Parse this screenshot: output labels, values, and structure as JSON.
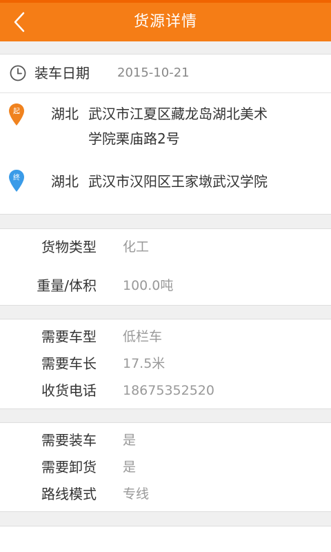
{
  "header": {
    "title": "货源详情",
    "bg_color": "#f57d16",
    "back_icon": "chevron-left-icon"
  },
  "loading": {
    "label": "装车日期",
    "date": "2015-10-21",
    "icon": "clock-icon"
  },
  "route": {
    "origin": {
      "badge": "起",
      "badge_color": "#f0821e",
      "province": "湖北",
      "detail_line1": "武汉市江夏区藏龙岛湖北美术",
      "detail_line2": "学院栗庙路2号"
    },
    "destination": {
      "badge": "终",
      "badge_color": "#3a9be8",
      "province": "湖北",
      "detail": "武汉市汉阳区王家墩武汉学院"
    }
  },
  "cargo": {
    "type_label": "货物类型",
    "type_value": "化工",
    "weight_label": "重量/体积",
    "weight_value": "100.0吨"
  },
  "vehicle": {
    "truck_type_label": "需要车型",
    "truck_type_value": "低栏车",
    "truck_length_label": "需要车长",
    "truck_length_value": "17.5米",
    "phone_label": "收货电话",
    "phone_value": "18675352520"
  },
  "service": {
    "loading_label": "需要装车",
    "loading_value": "是",
    "unloading_label": "需要卸货",
    "unloading_value": "是",
    "route_mode_label": "路线模式",
    "route_mode_value": "专线"
  }
}
